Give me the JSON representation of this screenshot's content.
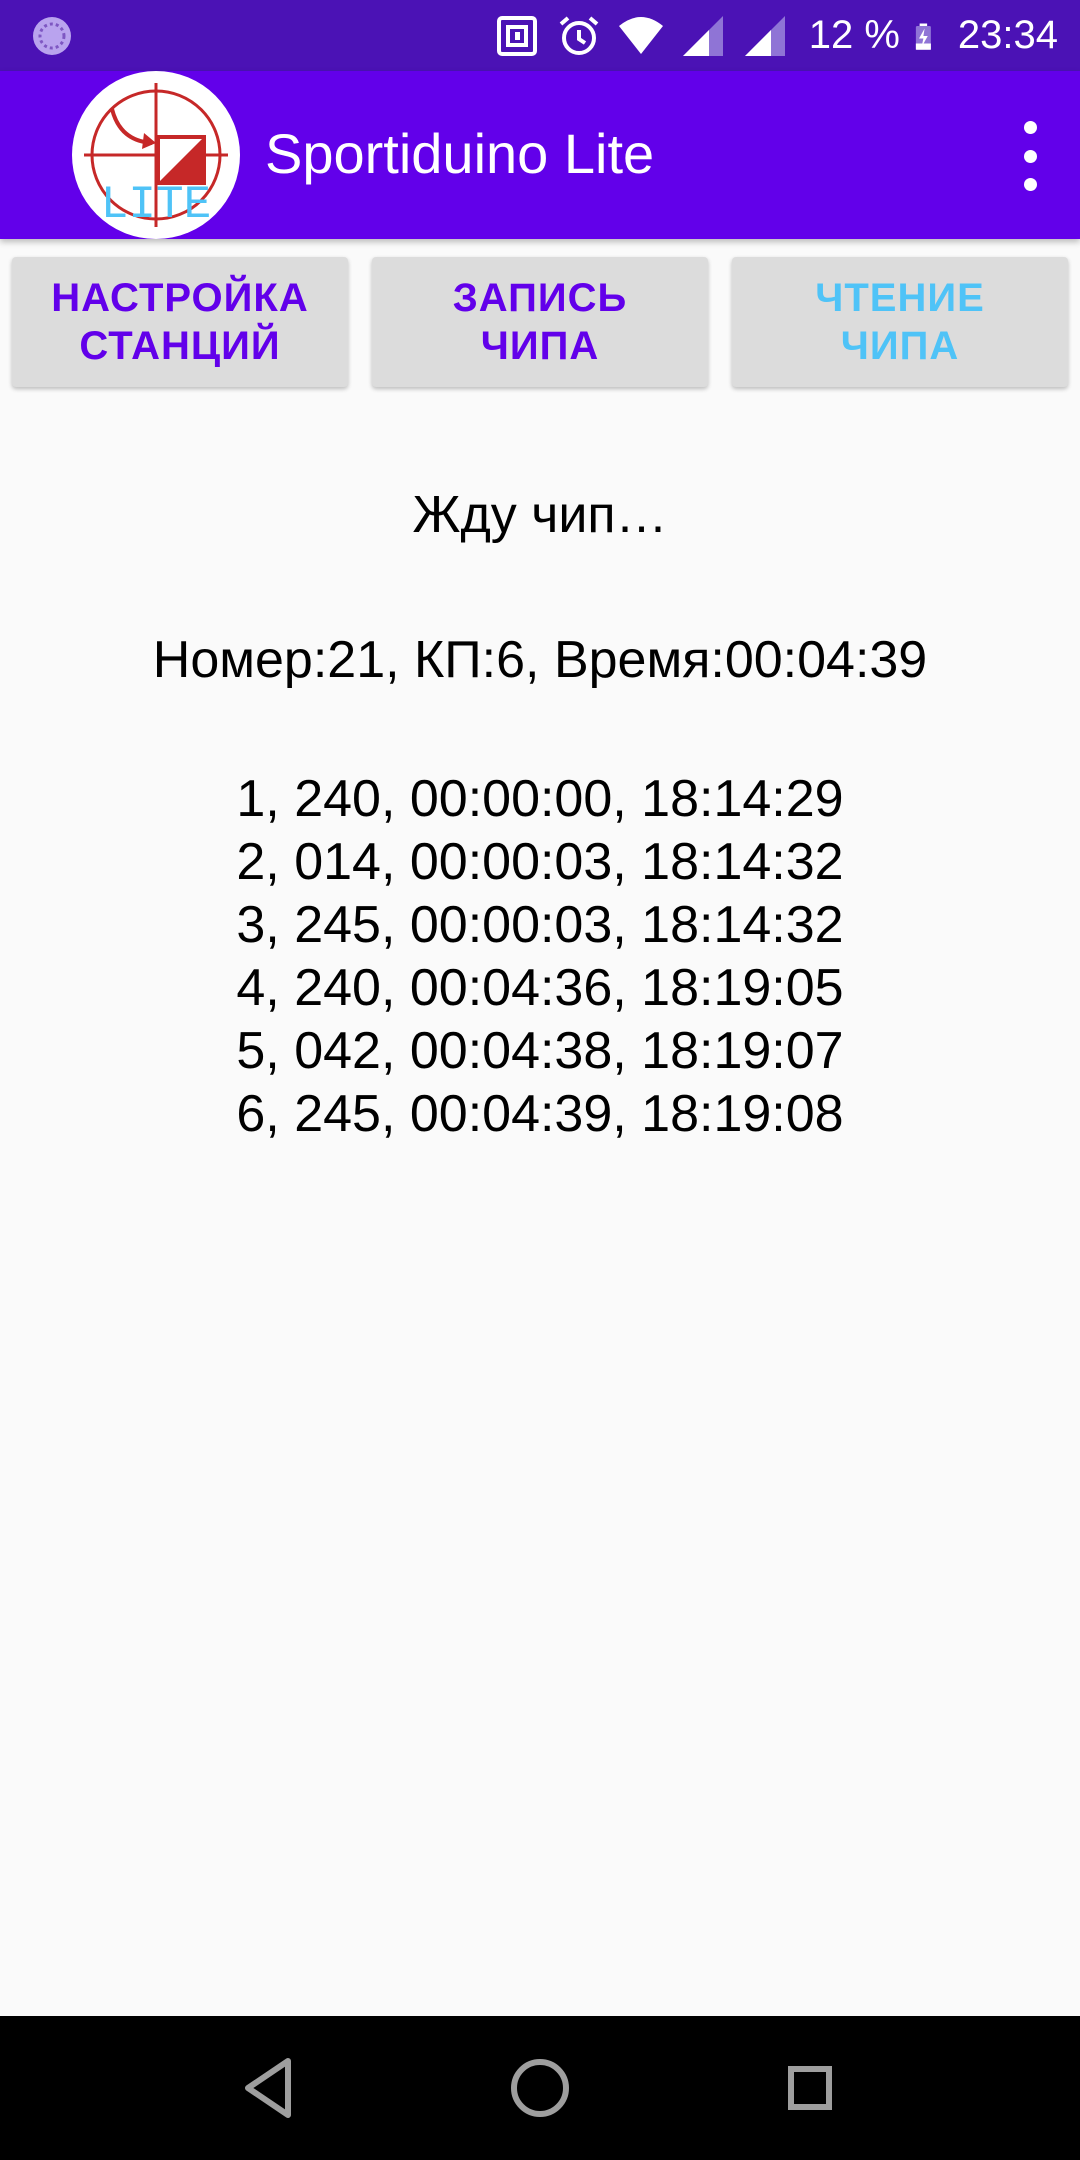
{
  "status_bar": {
    "battery_percent": "12 %",
    "time": "23:34",
    "icons": [
      "sync-icon",
      "nfc-icon",
      "alarm-icon",
      "wifi-icon",
      "signal-icon",
      "signal-icon-2",
      "battery-charging-icon"
    ]
  },
  "app_bar": {
    "title": "Sportiduino Lite",
    "logo_text": "LITE",
    "colors": {
      "background": "#6200ea",
      "status_bar": "#4b12b5"
    }
  },
  "buttons": {
    "stations_setup": "НАСТРОЙКА\nСТАНЦИЙ",
    "chip_write": "ЗАПИСЬ\nЧИПА",
    "chip_read": "ЧТЕНИЕ\nЧИПА",
    "colors": {
      "default": "#6200ea",
      "active": "#4fc3f7",
      "background": "#dcdcdc"
    }
  },
  "main": {
    "waiting_text": "Жду чип…",
    "summary_text": "Номер:21, КП:6, Время:00:04:39",
    "records": [
      "1, 240, 00:00:00, 18:14:29",
      "2, 014, 00:00:03, 18:14:32",
      "3, 245, 00:00:03, 18:14:32",
      "4, 240, 00:04:36, 18:19:05",
      "5, 042, 00:04:38, 18:19:07",
      "6, 245, 00:04:39, 18:19:08"
    ]
  },
  "nav_bar": {
    "icons": [
      "back-icon",
      "home-icon",
      "recents-icon"
    ]
  }
}
